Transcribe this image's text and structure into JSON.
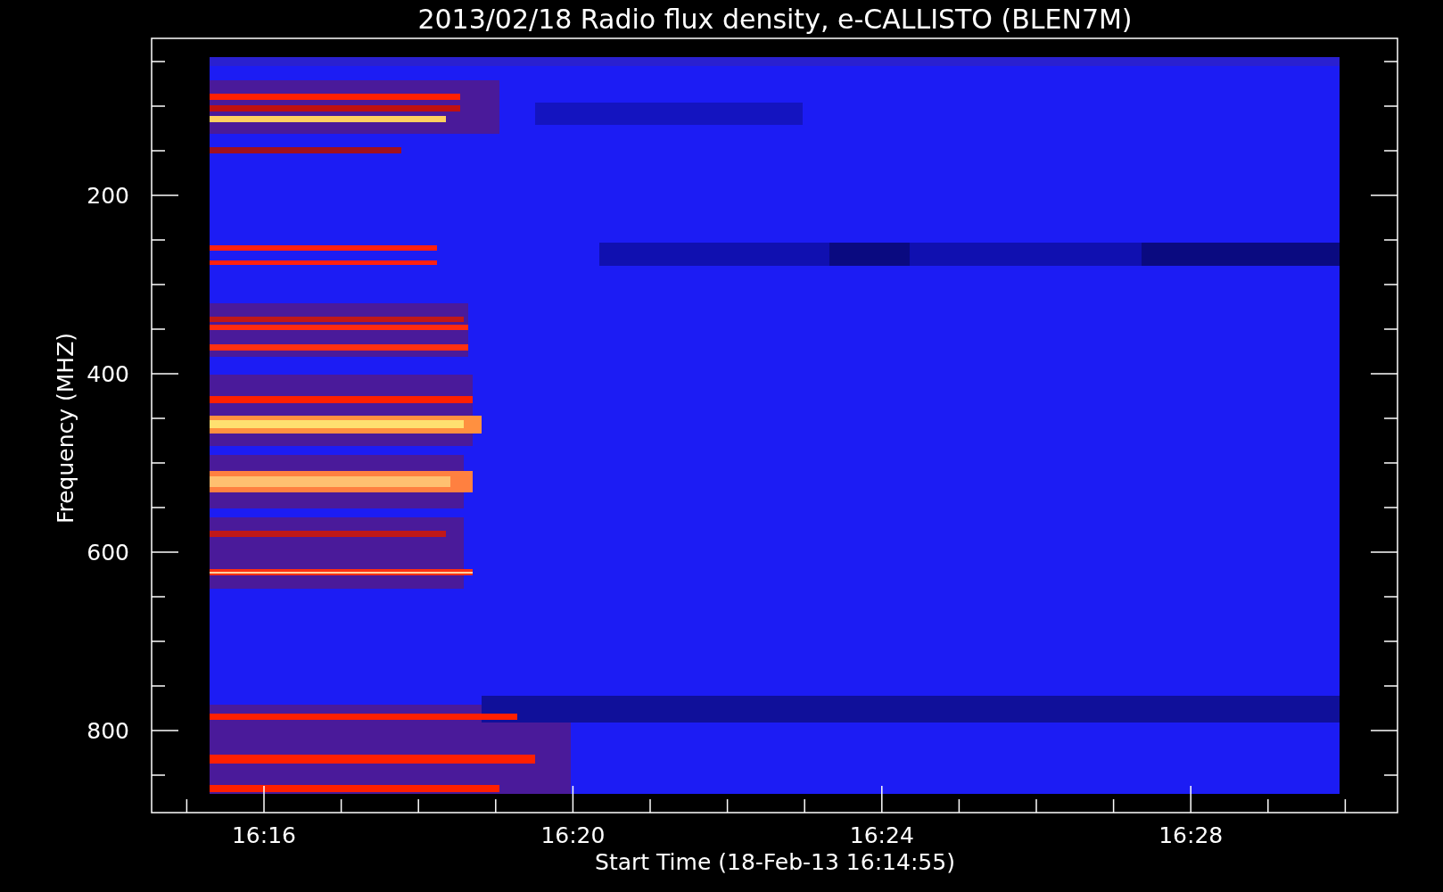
{
  "title": "2013/02/18  Radio flux density, e-CALLISTO (BLEN7M)",
  "y_axis": {
    "label": "Frequency (MHZ)",
    "tick_labels": [
      "200",
      "400",
      "600",
      "800"
    ]
  },
  "x_axis": {
    "label": "Start Time (18-Feb-13 16:14:55)",
    "tick_labels": [
      "16:16",
      "16:20",
      "16:24",
      "16:28"
    ]
  }
}
